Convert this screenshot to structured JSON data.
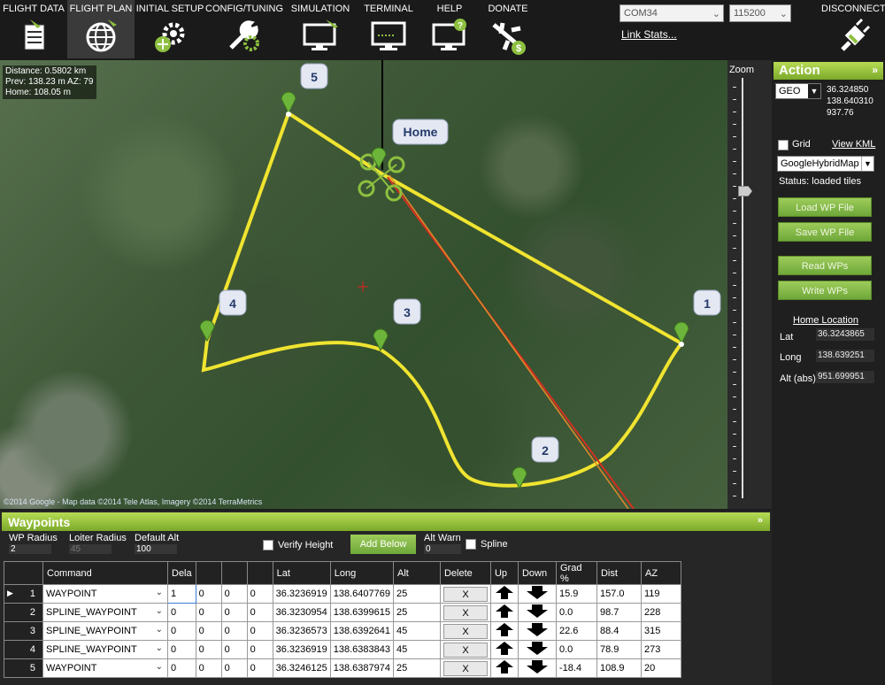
{
  "menu": [
    {
      "label": "FLIGHT DATA",
      "icon": "flight-data-icon"
    },
    {
      "label": "FLIGHT PLAN",
      "icon": "flight-plan-icon"
    },
    {
      "label": "INITIAL SETUP",
      "icon": "initial-setup-icon"
    },
    {
      "label": "CONFIG/TUNING",
      "icon": "config-tuning-icon"
    },
    {
      "label": "SIMULATION",
      "icon": "simulation-icon"
    },
    {
      "label": "TERMINAL",
      "icon": "terminal-icon"
    },
    {
      "label": "HELP",
      "icon": "help-icon"
    },
    {
      "label": "DONATE",
      "icon": "donate-icon"
    }
  ],
  "connection": {
    "port": "COM34",
    "baud": "115200",
    "link_stats": "Link Stats...",
    "disconnect": "DISCONNECT"
  },
  "map": {
    "info_distance": "Distance: 0.5802 km",
    "info_prev": "Prev: 138.23 m AZ: 79",
    "info_home": "Home: 108.05 m",
    "copyright": "©2014 Google - Map data ©2014 Tele Atlas, Imagery ©2014 TerraMetrics",
    "markers": [
      "1",
      "2",
      "3",
      "4",
      "5"
    ],
    "home_label": "Home",
    "zoom_label": "Zoom"
  },
  "action": {
    "title": "Action",
    "coord_mode": "GEO",
    "coord_lat": "36.324850",
    "coord_lng": "138.640310",
    "coord_alt": "937.76",
    "grid_label": "Grid",
    "view_kml": "View KML",
    "map_type": "GoogleHybridMap",
    "status": "Status: loaded tiles",
    "load_wp": "Load WP File",
    "save_wp": "Save WP File",
    "read_wps": "Read WPs",
    "write_wps": "Write WPs",
    "home_location": "Home Location",
    "lat_label": "Lat",
    "lat_value": "36.3243865",
    "long_label": "Long",
    "long_value": "138.639251",
    "alt_label": "Alt (abs)",
    "alt_value": "951.699951"
  },
  "waypoints": {
    "title": "Waypoints",
    "wp_radius_label": "WP Radius",
    "wp_radius": "2",
    "loiter_radius_label": "Loiter Radius",
    "loiter_radius": "45",
    "default_alt_label": "Default Alt",
    "default_alt": "100",
    "verify_height": "Verify Height",
    "add_below": "Add Below",
    "alt_warn_label": "Alt Warn",
    "alt_warn": "0",
    "spline": "Spline",
    "columns": [
      "Command",
      "Dela",
      "",
      "",
      "",
      "Lat",
      "Long",
      "Alt",
      "Delete",
      "Up",
      "Down",
      "Grad %",
      "Dist",
      "AZ"
    ],
    "rows": [
      {
        "n": "1",
        "cmd": "WAYPOINT",
        "p1": "1",
        "p2": "0",
        "p3": "0",
        "p4": "0",
        "lat": "36.3236919",
        "lng": "138.6407769",
        "alt": "25",
        "del": "X",
        "grad": "15.9",
        "dist": "157.0",
        "az": "119"
      },
      {
        "n": "2",
        "cmd": "SPLINE_WAYPOINT",
        "p1": "0",
        "p2": "0",
        "p3": "0",
        "p4": "0",
        "lat": "36.3230954",
        "lng": "138.6399615",
        "alt": "25",
        "del": "X",
        "grad": "0.0",
        "dist": "98.7",
        "az": "228"
      },
      {
        "n": "3",
        "cmd": "SPLINE_WAYPOINT",
        "p1": "0",
        "p2": "0",
        "p3": "0",
        "p4": "0",
        "lat": "36.3236573",
        "lng": "138.6392641",
        "alt": "45",
        "del": "X",
        "grad": "22.6",
        "dist": "88.4",
        "az": "315"
      },
      {
        "n": "4",
        "cmd": "SPLINE_WAYPOINT",
        "p1": "0",
        "p2": "0",
        "p3": "0",
        "p4": "0",
        "lat": "36.3236919",
        "lng": "138.6383843",
        "alt": "45",
        "del": "X",
        "grad": "0.0",
        "dist": "78.9",
        "az": "273"
      },
      {
        "n": "5",
        "cmd": "WAYPOINT",
        "p1": "0",
        "p2": "0",
        "p3": "0",
        "p4": "0",
        "lat": "36.3246125",
        "lng": "138.6387974",
        "alt": "25",
        "del": "X",
        "grad": "-18.4",
        "dist": "108.9",
        "az": "20"
      }
    ]
  },
  "colors": {
    "accent": "#8dc03f",
    "route": "#f0e430",
    "heading": "#d03020"
  }
}
